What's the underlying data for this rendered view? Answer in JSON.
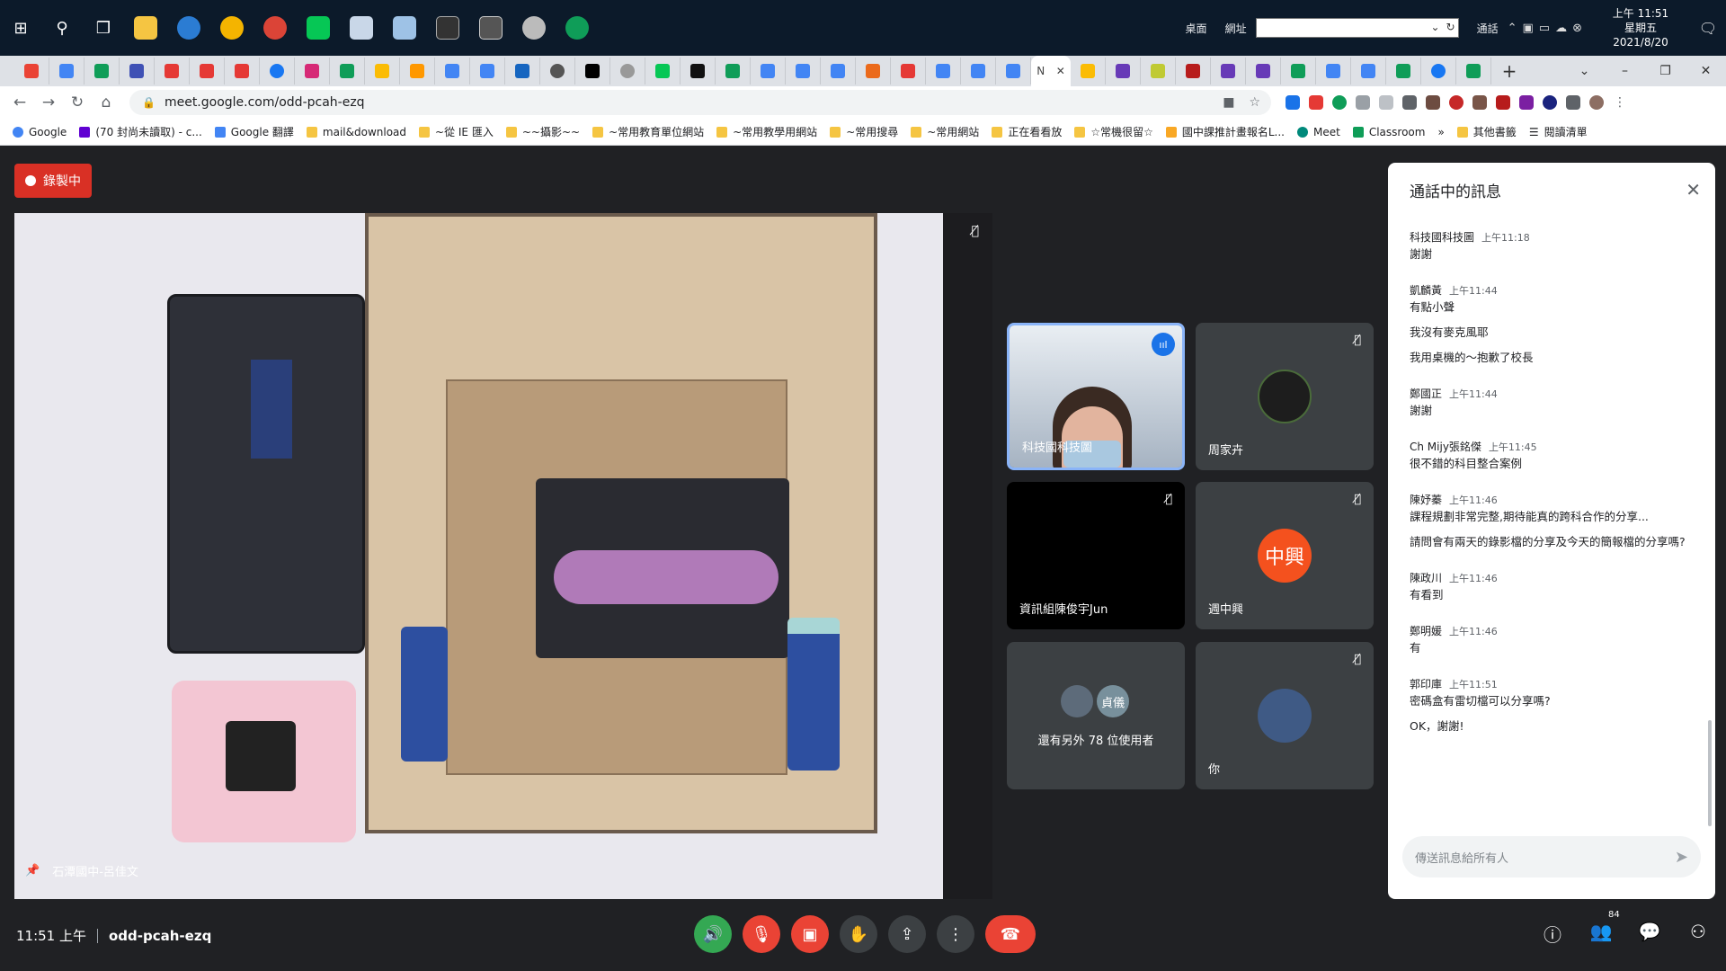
{
  "taskbar": {
    "desktop_label": "桌面",
    "address_label": "網址",
    "network_label": "通話",
    "clock_time": "上午 11:51",
    "clock_weekday": "星期五",
    "clock_date": "2021/8/20"
  },
  "browser": {
    "url": "meet.google.com/odd-pcah-ezq",
    "active_tab_title": "N"
  },
  "bookmarks": [
    "Google",
    "(70 封尚未讀取) - c...",
    "Google 翻譯",
    "mail&download",
    "~從 IE 匯入",
    "~~攝影~~",
    "~常用教育單位網站",
    "~常用教學用網站",
    "~常用搜尋",
    "~常用網站",
    "正在看看放",
    "☆常機很留☆",
    "國中課推計畫報名L...",
    "Meet",
    "Classroom",
    "其他書籤",
    "閱讀清單"
  ],
  "meet": {
    "recording_label": "錄製中",
    "presenter_name": "石潭國中-呂佳文",
    "participants": [
      {
        "name": "科技國科技圖",
        "avatar": ""
      },
      {
        "name": "周家卉",
        "avatar": ""
      },
      {
        "name": "資訊組陳俊宇Jun",
        "avatar": ""
      },
      {
        "name": "週中興",
        "avatar": "中興"
      },
      {
        "name": "還有另外 78 位使用者",
        "avatar": "貞儀"
      },
      {
        "name": "你",
        "avatar": ""
      }
    ]
  },
  "chat": {
    "title": "通話中的訊息",
    "messages": [
      {
        "sender": "科技國科技圖",
        "time": "上午11:18",
        "lines": [
          "謝謝"
        ]
      },
      {
        "sender": "凱麟黃",
        "time": "上午11:44",
        "lines": [
          "有點小聲",
          "我沒有麥克風耶",
          "我用桌機的～抱歉了校長"
        ]
      },
      {
        "sender": "鄭國正",
        "time": "上午11:44",
        "lines": [
          "謝謝"
        ]
      },
      {
        "sender": "Ch Mijy張銘傑",
        "time": "上午11:45",
        "lines": [
          "很不錯的科目整合案例"
        ]
      },
      {
        "sender": "陳妤蓁",
        "time": "上午11:46",
        "lines": [
          "課程規劃非常完整,期待能真的跨科合作的分享...",
          "請問會有兩天的錄影檔的分享及今天的簡報檔的分享嗎?"
        ]
      },
      {
        "sender": "陳政川",
        "time": "上午11:46",
        "lines": [
          "有看到"
        ]
      },
      {
        "sender": "鄭明媛",
        "time": "上午11:46",
        "lines": [
          "有"
        ]
      },
      {
        "sender": "郭印庫",
        "time": "上午11:51",
        "lines": [
          "密碼盒有雷切檔可以分享嗎?",
          "OK，謝謝!"
        ]
      }
    ],
    "input_placeholder": "傳送訊息給所有人"
  },
  "bottom": {
    "time": "11:51 上午",
    "meeting_code": "odd-pcah-ezq",
    "participant_count": "84"
  },
  "colors": {
    "accent": "#1a73e8",
    "danger": "#ea4335",
    "success": "#34a853",
    "meet_bg": "#202124"
  }
}
